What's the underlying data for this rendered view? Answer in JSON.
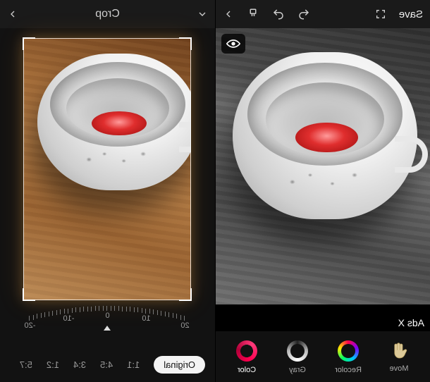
{
  "left": {
    "topbar": {
      "save_label": "Save"
    },
    "ads_label": "Ads X",
    "tools": {
      "move": "Move",
      "recolor": "Recolor",
      "gray": "Gray",
      "color": "Color"
    }
  },
  "right": {
    "title": "Crop",
    "dial": {
      "ticks": [
        "20",
        "10",
        "0",
        "-10",
        "-20"
      ],
      "value": 0
    },
    "ratios": {
      "original": "Original",
      "r1_1": "1:1",
      "r4_5": "4:5",
      "r3_4": "3:4",
      "r1_2": "1:2",
      "r5_7": "5:7"
    }
  }
}
